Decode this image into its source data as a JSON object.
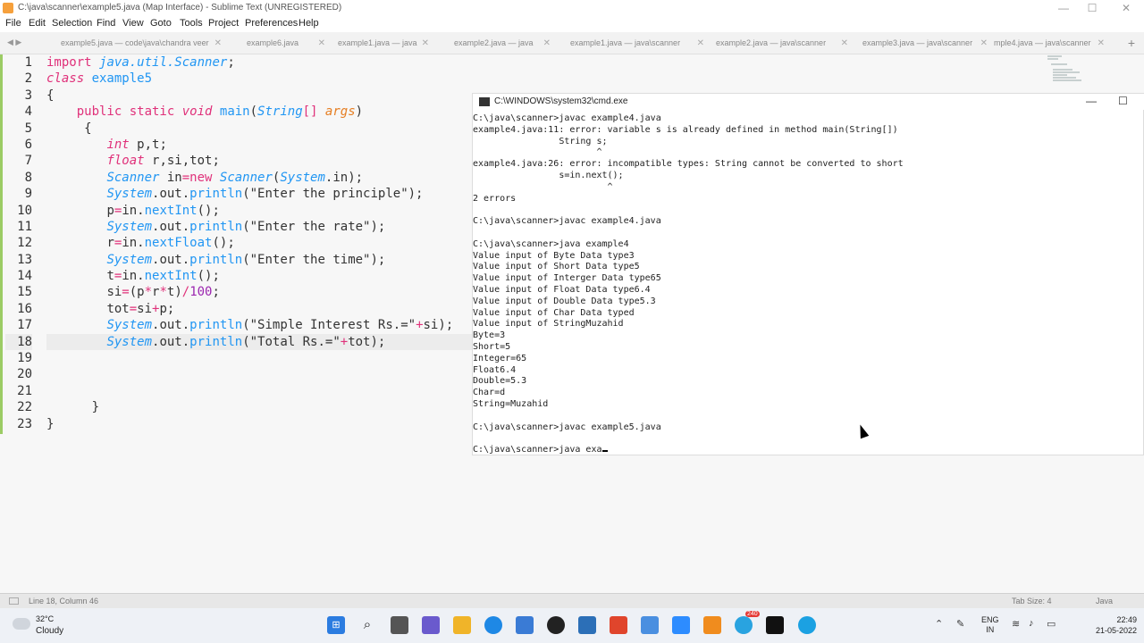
{
  "window": {
    "title": "C:\\java\\scanner\\example5.java (Map Interface) - Sublime Text (UNREGISTERED)",
    "min": "—",
    "max": "☐",
    "close": "✕"
  },
  "menu": [
    "File",
    "Edit",
    "Selection",
    "Find",
    "View",
    "Goto",
    "Tools",
    "Project",
    "Preferences",
    "Help"
  ],
  "tabs": [
    "example5.java — code\\java\\chandra veer",
    "example6.java",
    "example1.java — java",
    "example2.java — java",
    "example1.java — java\\scanner",
    "example2.java — java\\scanner",
    "example3.java — java\\scanner",
    "mple4.java — java\\scanner"
  ],
  "tab_nav": "◀ ▶",
  "tab_close": "✕",
  "tab_add": "+",
  "editor": {
    "line_numbers": [
      "1",
      "2",
      "3",
      "4",
      "5",
      "6",
      "7",
      "8",
      "9",
      "10",
      "11",
      "12",
      "13",
      "14",
      "15",
      "16",
      "17",
      "18",
      "19",
      "20",
      "21",
      "22",
      "23"
    ],
    "current_line": 18
  },
  "console": {
    "title": "C:\\WINDOWS\\system32\\cmd.exe",
    "min": "—",
    "max": "☐",
    "lines": [
      "C:\\java\\scanner>javac example4.java",
      "example4.java:11: error: variable s is already defined in method main(String[])",
      "                String s;",
      "                       ^",
      "example4.java:26: error: incompatible types: String cannot be converted to short",
      "                s=in.next();",
      "                         ^",
      "2 errors",
      "",
      "C:\\java\\scanner>javac example4.java",
      "",
      "C:\\java\\scanner>java example4",
      "Value input of Byte Data type3",
      "Value input of Short Data type5",
      "Value input of Interger Data type65",
      "Value input of Float Data type6.4",
      "Value input of Double Data type5.3",
      "Value input of Char Data typed",
      "Value input of StringMuzahid",
      "Byte=3",
      "Short=5",
      "Integer=65",
      "Float6.4",
      "Double=5.3",
      "Char=d",
      "String=Muzahid",
      "",
      "C:\\java\\scanner>javac example5.java",
      ""
    ],
    "prompt": "C:\\java\\scanner>java exa"
  },
  "status": {
    "position": "Line 18, Column 46",
    "tab_size": "Tab Size: 4",
    "syntax": "Java"
  },
  "taskbar": {
    "temperature": "32°C",
    "condition": "Cloudy",
    "badge": "240",
    "lang1": "ENG",
    "lang2": "IN",
    "time": "22:49",
    "date": "21-05-2022"
  }
}
